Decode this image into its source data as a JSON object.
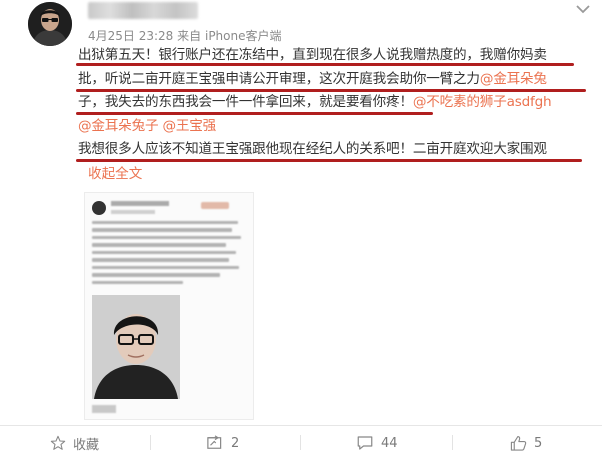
{
  "post": {
    "timestamp": "4月25日 23:28",
    "source_prefix": "来自",
    "source": "iPhone客户端",
    "lines": [
      {
        "a": "出狱第五天！银行账户还在冻结中，直到现在很多人说我赠热度的，我赠你妈卖",
        "b": ""
      },
      {
        "a": "批，听说二亩开庭王宝强申请公开审理，这次开庭我会助你一臂之力",
        "b": "@金耳朵兔"
      },
      {
        "a": "子，我失去的东西我会一件一件拿回来，就是要看你疼！",
        "b": "@不吃素的狮子asdfgh"
      },
      {
        "a": "",
        "b": "@金耳朵兔子 @王宝强"
      },
      {
        "a": "我想很多人应该不知道王宝强跟他现在经纪人的关系吧！二亩开庭欢迎大家围观",
        "b": ""
      }
    ],
    "collapse": "收起全文"
  },
  "actions": {
    "favorite": "收藏",
    "repost": "2",
    "comment": "44",
    "like": "5"
  },
  "colors": {
    "mention": "#eb7350",
    "underline": "#b01e1e",
    "meta": "#8a8a8a"
  },
  "icons": [
    "avatar",
    "chevron-down-icon",
    "star-icon",
    "repost-icon",
    "comment-icon",
    "like-icon"
  ]
}
